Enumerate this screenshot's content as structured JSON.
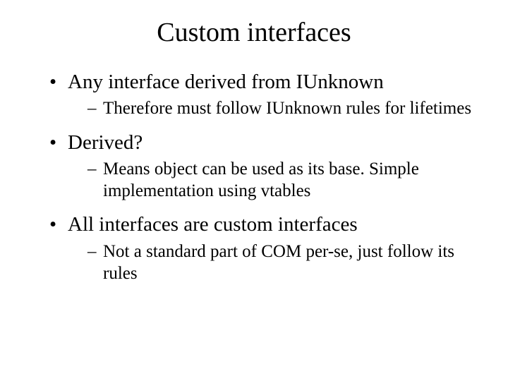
{
  "title": "Custom interfaces",
  "bullets": [
    {
      "text": "Any interface derived from IUnknown",
      "sub": [
        "Therefore must follow IUnknown rules for lifetimes"
      ]
    },
    {
      "text": "Derived?",
      "sub": [
        "Means object can be used as its base.  Simple implementation using vtables"
      ]
    },
    {
      "text": "All interfaces are custom interfaces",
      "sub": [
        "Not a standard part of COM per-se, just follow its rules"
      ]
    }
  ]
}
